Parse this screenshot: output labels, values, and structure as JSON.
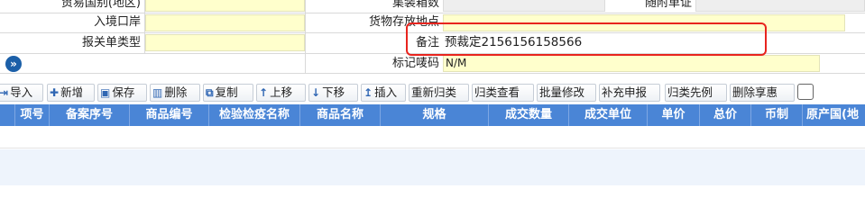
{
  "form": {
    "trade_country_label": "贸易国别(地区)",
    "container_count_label": "集装箱数",
    "attached_docs_label": "随附单证",
    "entry_port_label": "入境口岸",
    "goods_location_label": "货物存放地点",
    "customs_form_type_label": "报关单类型",
    "remark_label": "备注",
    "remark_value": "预裁定2156156158566",
    "marks_label": "标记唛码",
    "marks_value": "N/M",
    "expand_icon": "double-chevron-icon"
  },
  "toolbar": {
    "buttons": [
      {
        "label": "导入",
        "icon": "import-icon",
        "glyph": "⇥"
      },
      {
        "label": "新增",
        "icon": "plus-icon",
        "glyph": "✚"
      },
      {
        "label": "保存",
        "icon": "save-icon",
        "glyph": "▣"
      },
      {
        "label": "删除",
        "icon": "trash-icon",
        "glyph": "▥"
      },
      {
        "label": "复制",
        "icon": "copy-icon",
        "glyph": "⧉"
      },
      {
        "label": "上移",
        "icon": "arrow-up-icon",
        "glyph": "↑"
      },
      {
        "label": "下移",
        "icon": "arrow-down-icon",
        "glyph": "↓"
      },
      {
        "label": "插入",
        "icon": "insert-icon",
        "glyph": "↥"
      },
      {
        "label": "重新归类",
        "icon": "",
        "glyph": ""
      },
      {
        "label": "归类查看",
        "icon": "",
        "glyph": ""
      },
      {
        "label": "批量修改",
        "icon": "",
        "glyph": ""
      },
      {
        "label": "补充申报",
        "icon": "",
        "glyph": ""
      },
      {
        "label": "归类先例",
        "icon": "",
        "glyph": ""
      },
      {
        "label": "删除享惠",
        "icon": "",
        "glyph": ""
      }
    ]
  },
  "table": {
    "columns": [
      "项号",
      "备案序号",
      "商品编号",
      "检验检疫名称",
      "商品名称",
      "规格",
      "成交数量",
      "成交单位",
      "单价",
      "总价",
      "币制",
      "原产国(地"
    ]
  },
  "colors": {
    "header_bg": "#4a85d6",
    "highlight_border": "#e8241e",
    "input_bg": "#ffffcc"
  }
}
